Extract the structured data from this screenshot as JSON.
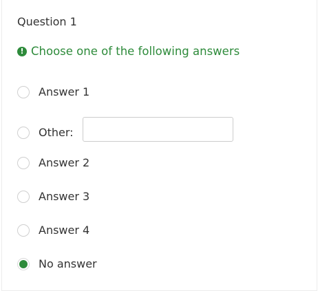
{
  "question": {
    "title": "Question 1",
    "instruction": "Choose one of the following answers",
    "instruction_icon": "exclamation-circle-icon",
    "accent_color": "#2e8b3b"
  },
  "options": [
    {
      "label": "Answer 1",
      "selected": false
    },
    {
      "label": "Other:",
      "selected": false,
      "has_text_input": true,
      "input_value": ""
    },
    {
      "label": "Answer 2",
      "selected": false
    },
    {
      "label": "Answer 3",
      "selected": false
    },
    {
      "label": "Answer 4",
      "selected": false
    },
    {
      "label": "No answer",
      "selected": true
    }
  ]
}
